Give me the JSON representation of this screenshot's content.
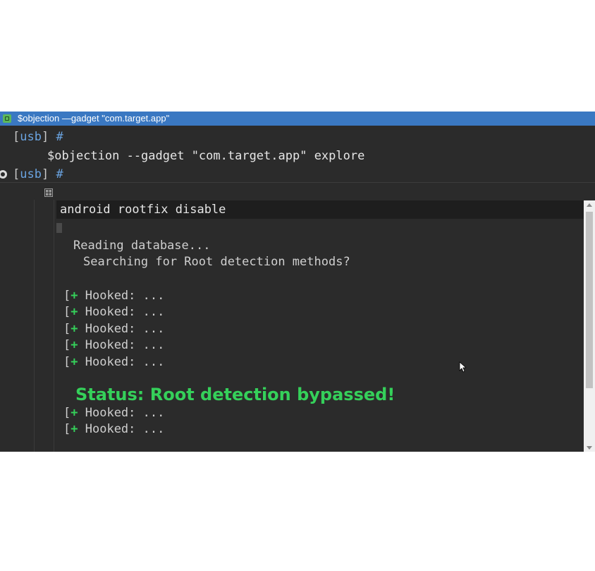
{
  "window": {
    "title": "$objection —gadget \"com.target.app\""
  },
  "terminal": {
    "prompt_1": {
      "bracket_open": "[",
      "usb": "usb",
      "bracket_close": "]",
      "hash": "#"
    },
    "command_1": "$objection --gadget \"com.target.app\" explore",
    "prompt_2": {
      "bracket_open": "[",
      "usb": "usb",
      "bracket_close": "]",
      "hash": "#"
    },
    "editor_input": "android rootfix disable",
    "reading": "Reading database...",
    "searching": "Searching for Root detection methods?",
    "hooked": [
      {
        "open": "[",
        "plus": "+",
        "text": "Hooked: ..."
      },
      {
        "open": "[",
        "plus": "+",
        "text": "Hooked: ..."
      },
      {
        "open": "[",
        "plus": "+",
        "text": "Hooked: ..."
      },
      {
        "open": "[",
        "plus": "+",
        "text": "Hooked: ..."
      },
      {
        "open": "[",
        "plus": "+",
        "text": "Hooked: ..."
      }
    ],
    "status": "Status: Root detection bypassed!",
    "hooked_after": [
      {
        "open": "[",
        "plus": "+",
        "text": "Hooked: ..."
      },
      {
        "open": "[",
        "plus": "+",
        "text": "Hooked: ..."
      }
    ]
  },
  "colors": {
    "titlebar": "#3a78c2",
    "terminal_bg": "#2b2b2b",
    "prompt_blue": "#6aa3e0",
    "success_green": "#35d05a"
  },
  "icons": {
    "app": "terminal-app-icon",
    "grid": "grid-icon",
    "side": "record-icon",
    "cursor": "mouse-pointer-icon"
  }
}
